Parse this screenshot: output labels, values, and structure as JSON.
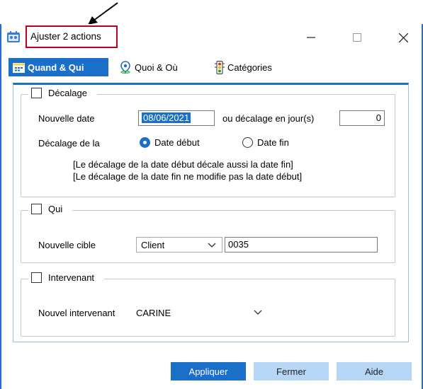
{
  "window": {
    "title": "Ajuster 2 actions",
    "controls": {
      "minimize": "—",
      "maximize": "☐",
      "close": "✕"
    }
  },
  "tabs": [
    {
      "label": "Quand & Qui",
      "active": true,
      "icon": "calendar-icon"
    },
    {
      "label": "Quoi & Où",
      "active": false,
      "icon": "map-pin-icon"
    },
    {
      "label": "Catégories",
      "active": false,
      "icon": "traffic-light-icon"
    }
  ],
  "decalage": {
    "legend": "Décalage",
    "checked": false,
    "new_date_label": "Nouvelle date",
    "new_date_value": "08/06/2021",
    "offset_label": "ou décalage en jour(s)",
    "offset_value": "0",
    "of_label": "Décalage de la",
    "radio_start": {
      "label": "Date début",
      "selected": true
    },
    "radio_end": {
      "label": "Date fin",
      "selected": false
    },
    "note1": "[Le décalage de la date début décale aussi la date fin]",
    "note2": "[Le décalage de la date fin ne modifie pas la date début]"
  },
  "qui": {
    "legend": "Qui",
    "checked": false,
    "target_label": "Nouvelle cible",
    "target_type": "Client",
    "target_value": "0035"
  },
  "intervenant": {
    "legend": "Intervenant",
    "checked": false,
    "label": "Nouvel intervenant",
    "value": "CARINE"
  },
  "footer": {
    "apply": "Appliquer",
    "close": "Fermer",
    "help": "Aide"
  },
  "colors": {
    "accent": "#1a6fc8",
    "secondary_button": "#b7d5f5",
    "annotation_red": "#c0001a"
  }
}
